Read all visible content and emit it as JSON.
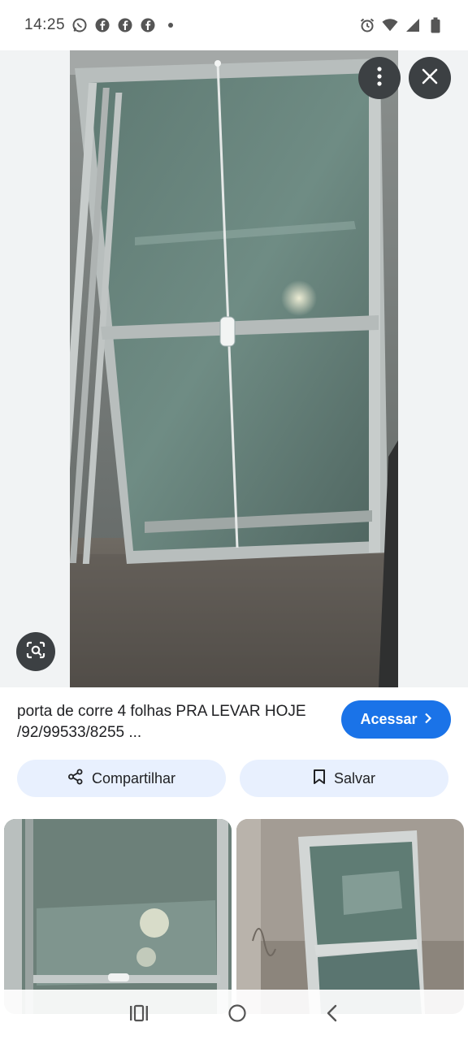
{
  "status_bar": {
    "time": "14:25",
    "left_icons": [
      "whatsapp-icon",
      "facebook-icon",
      "facebook-icon",
      "facebook-icon",
      "dot-icon"
    ],
    "right_icons": [
      "alarm-icon",
      "wifi-icon",
      "signal-icon",
      "battery-icon"
    ]
  },
  "result": {
    "title": "porta de corre 4 folhas PRA LEVAR HOJE /92/99533/8255 ...",
    "visit_label": "Acessar",
    "share_label": "Compartilhar",
    "save_label": "Salvar"
  },
  "colors": {
    "accent": "#1a73e8",
    "pill_bg": "#e8f0fe",
    "dark_button": "#3c4043"
  }
}
